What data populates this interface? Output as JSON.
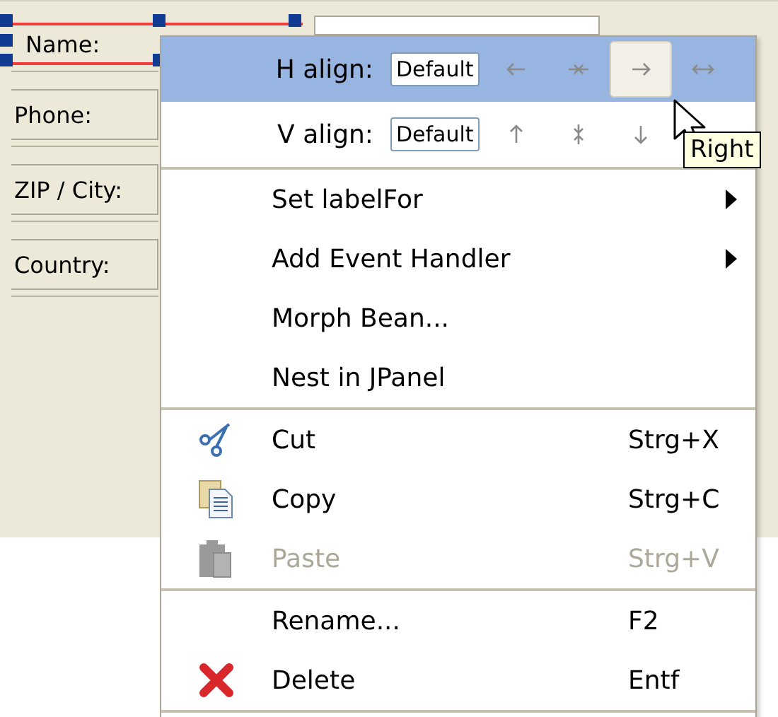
{
  "form": {
    "labels": [
      {
        "text": "Name:",
        "selected": true
      },
      {
        "text": "Phone:",
        "selected": false
      },
      {
        "text": "ZIP / City:",
        "selected": false
      },
      {
        "text": "Country:",
        "selected": false
      }
    ]
  },
  "context_menu": {
    "align_rows": [
      {
        "label": "H align:",
        "value": "Default",
        "selected": true,
        "buttons": [
          {
            "kind": "left",
            "selected": false
          },
          {
            "kind": "center",
            "selected": false
          },
          {
            "kind": "right",
            "selected": true
          },
          {
            "kind": "fill",
            "selected": false
          }
        ]
      },
      {
        "label": "V align:",
        "value": "Default",
        "selected": false,
        "buttons": [
          {
            "kind": "up",
            "selected": false
          },
          {
            "kind": "middle",
            "selected": false
          },
          {
            "kind": "down",
            "selected": false
          }
        ]
      }
    ],
    "groups": [
      [
        {
          "label": "Set labelFor",
          "submenu": true,
          "disabled": false
        },
        {
          "label": "Add Event Handler",
          "submenu": true,
          "disabled": false
        },
        {
          "label": "Morph Bean...",
          "submenu": false,
          "disabled": false
        },
        {
          "label": "Nest in JPanel",
          "submenu": false,
          "disabled": false
        }
      ],
      [
        {
          "label": "Cut",
          "kind": "scissors",
          "shortcut": "Strg+X",
          "submenu": false,
          "disabled": false
        },
        {
          "label": "Copy",
          "kind": "copy",
          "shortcut": "Strg+C",
          "submenu": false,
          "disabled": false
        },
        {
          "label": "Paste",
          "kind": "paste",
          "shortcut": "Strg+V",
          "submenu": false,
          "disabled": true
        }
      ],
      [
        {
          "label": "Rename...",
          "shortcut": "F2",
          "submenu": false,
          "disabled": false
        },
        {
          "label": "Delete",
          "kind": "delete",
          "shortcut": "Entf",
          "submenu": false,
          "disabled": false
        }
      ]
    ]
  },
  "tooltip": {
    "text": "Right"
  }
}
